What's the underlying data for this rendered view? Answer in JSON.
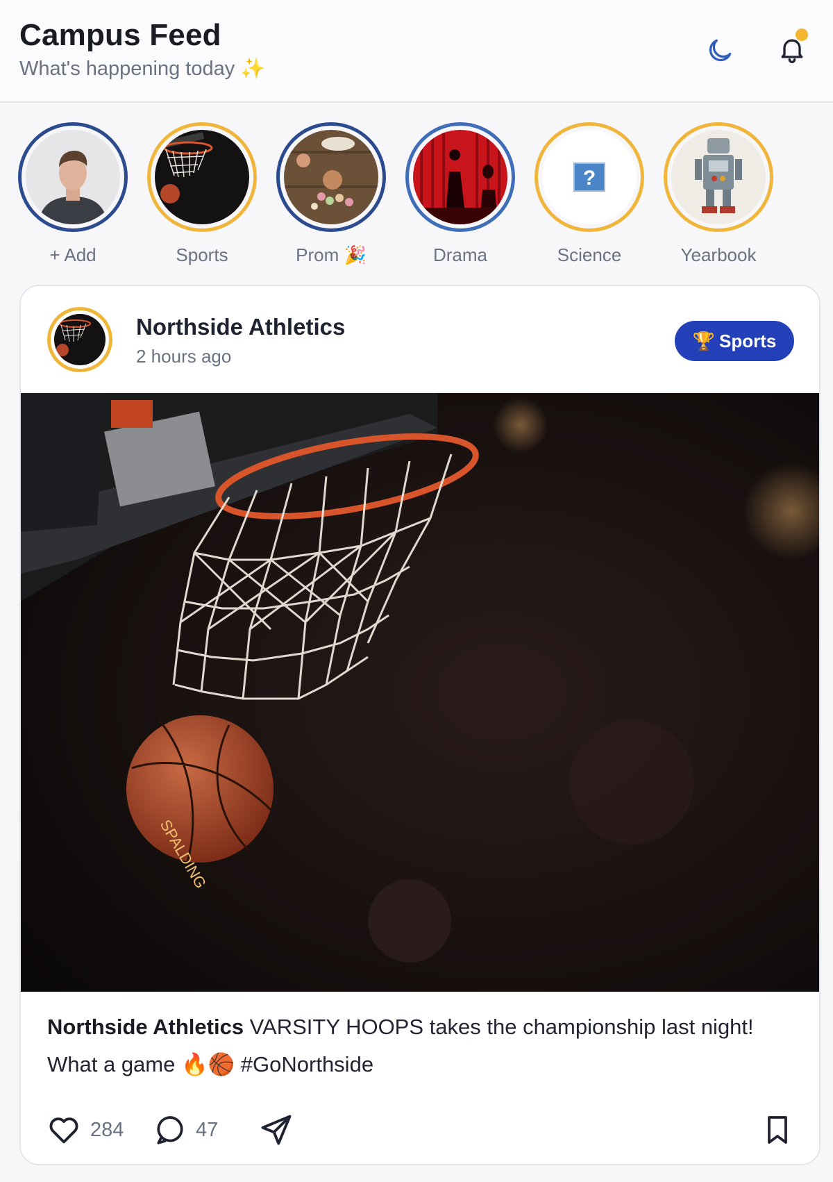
{
  "header": {
    "title": "Campus Feed",
    "subtitle": "What's happening today ✨",
    "has_notification": true
  },
  "stories": [
    {
      "label": "+ Add",
      "ring": "blue"
    },
    {
      "label": "Sports",
      "ring": "gold"
    },
    {
      "label": "Prom 🎉",
      "ring": "blue"
    },
    {
      "label": "Drama",
      "ring": "mid-blue"
    },
    {
      "label": "Science",
      "ring": "gold"
    },
    {
      "label": "Yearbook",
      "ring": "gold"
    }
  ],
  "post": {
    "author": "Northside Athletics",
    "time": "2 hours ago",
    "tag_icon": "🏆",
    "tag": "Sports",
    "caption_author": "Northside Athletics",
    "caption_text": " VARSITY HOOPS takes the championship last night! What a game 🔥🏀 #GoNorthside",
    "likes": "284",
    "comments": "47"
  },
  "colors": {
    "accent_blue": "#2340b8",
    "gold": "#f0b63c",
    "ring_blue": "#2c4b8f"
  }
}
